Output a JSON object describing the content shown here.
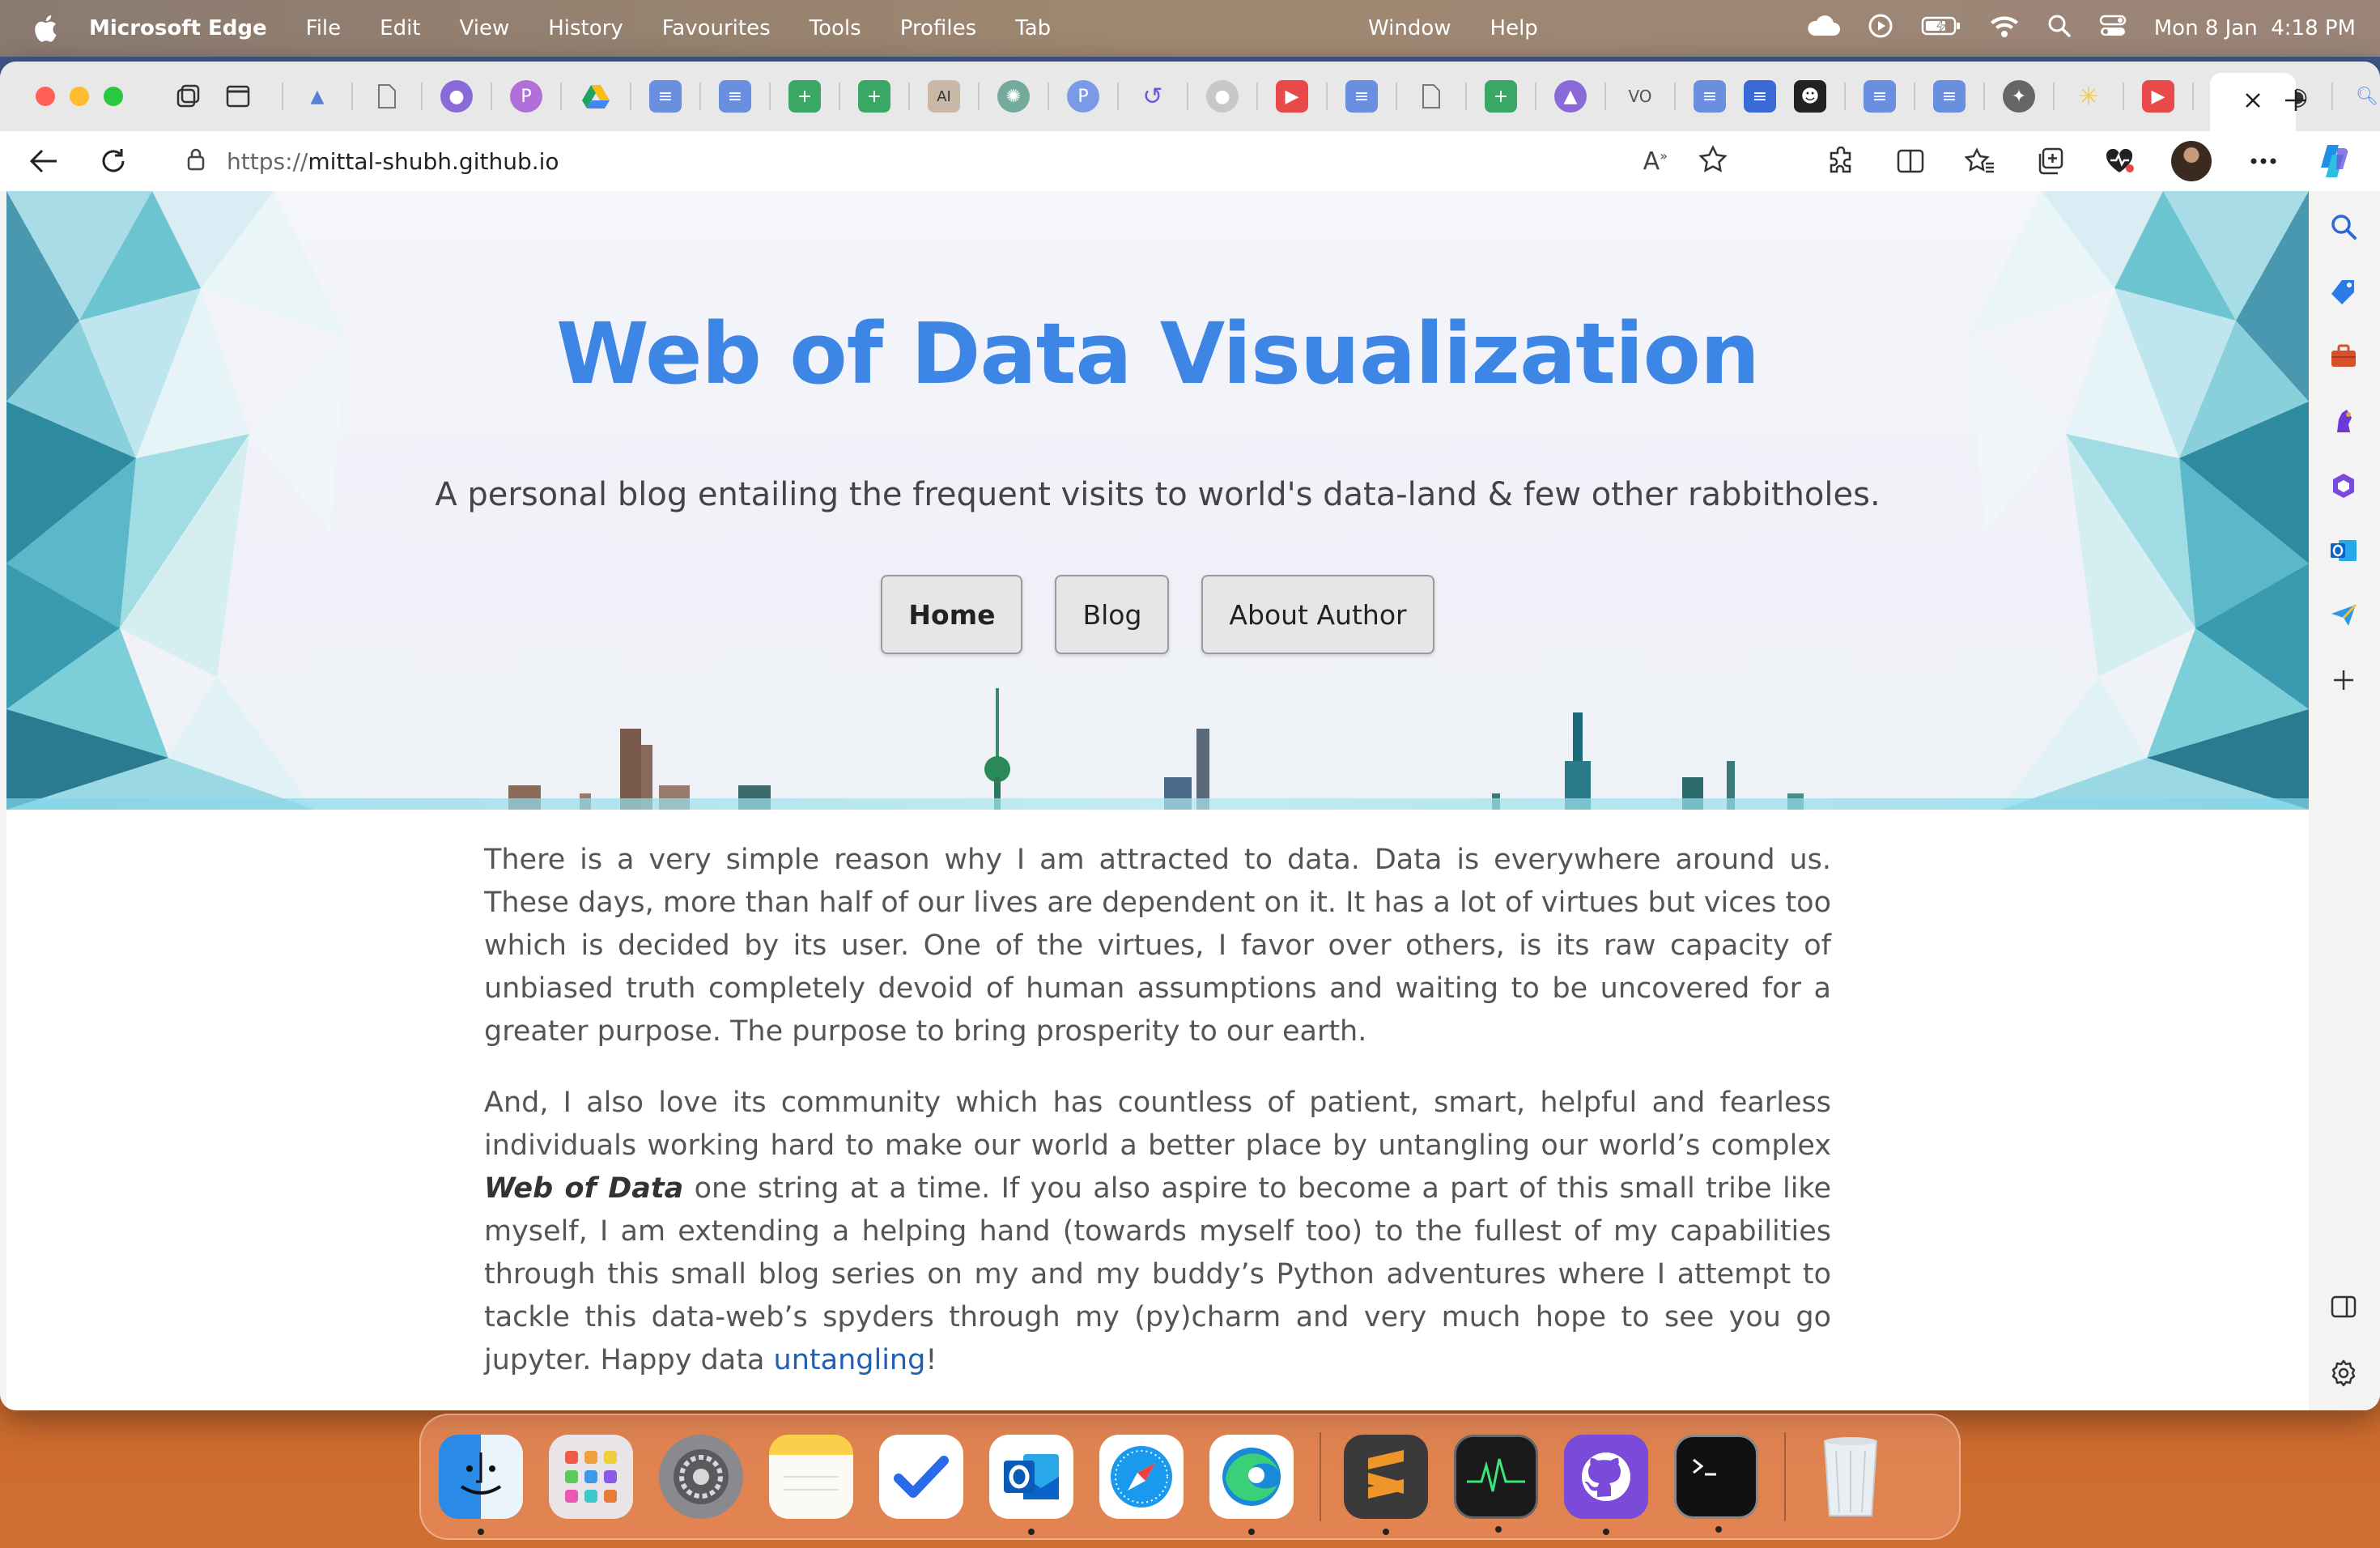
{
  "menubar": {
    "app_name": "Microsoft Edge",
    "menus": [
      "File",
      "Edit",
      "View",
      "History",
      "Favourites",
      "Tools",
      "Profiles",
      "Tab"
    ],
    "center_menus": [
      "Window",
      "Help"
    ],
    "datetime": "Mon 8 Jan  4:18 PM"
  },
  "browser": {
    "url_protocol": "https://",
    "url_host": "mittal-shubh.github.io"
  },
  "hero": {
    "title": "Web of Data Visualization",
    "subtitle": "A personal blog entailing the frequent visits to world's data-land & few other rabbitholes.",
    "nav": {
      "home": "Home",
      "blog": "Blog",
      "about": "About Author"
    }
  },
  "article": {
    "p1": "There is a very simple reason why I am attracted to data. Data is everywhere around us. These days, more than half of our lives are dependent on it. It has a lot of virtues but vices too which is decided by its user. One of the virtues, I favor over others, is its raw capacity of unbiased truth completely devoid of human assumptions and waiting to be uncovered for a greater purpose. The purpose to bring prosperity to our earth.",
    "p2_a": "And, I also love its community which has countless of patient, smart, helpful and fearless individuals working hard to make our world a better place by untangling our world’s complex ",
    "p2_em": "Web of Data",
    "p2_b": " one string at a time. If you also aspire to become a part of this small tribe like myself, I am extending a helping hand (towards myself too) to the fullest of my capabilities through this small blog series on my and my buddy’s Python adventures where I attempt to tackle this data-web’s spyders through my (py)charm and very much hope to see you go jupyter. Happy data ",
    "p2_link": "untangling",
    "p2_end": "!"
  },
  "colors": {
    "title_blue": "#3d86e6",
    "link_blue": "#1f5fb5"
  }
}
